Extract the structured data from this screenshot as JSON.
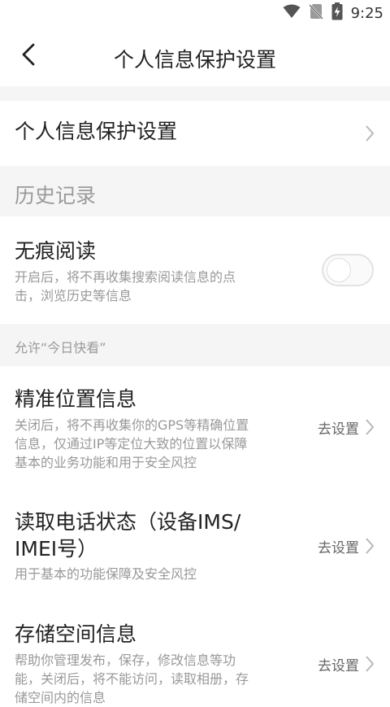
{
  "status_bar": {
    "time": "9:25",
    "icons": [
      "wifi-icon",
      "no-sim-icon",
      "battery-charging-icon"
    ]
  },
  "header": {
    "title": "个人信息保护设置",
    "back_icon": "chevron-left-icon"
  },
  "main": {
    "personal_info_item": {
      "label": "个人信息保护设置"
    },
    "history_section": {
      "title": "历史记录"
    },
    "incognito": {
      "title": "无痕阅读",
      "desc_line1": "开启后，将不再收集搜索阅读信息的点",
      "desc_line2": "击，浏览历史等信息",
      "enabled": false
    },
    "permissions_header": {
      "title": "允许“今日快看”"
    },
    "permissions": [
      {
        "title_line1": "精准位置信息",
        "title_line2": "",
        "desc_line1": "关闭后，将不再收集你的GPS等精确位置",
        "desc_line2": "信息，仅通过IP等定位大致的位置以保障",
        "desc_line3": "基本的业务功能和用于安全风控",
        "action": "去设置"
      },
      {
        "title_line1": "读取电话状态（设备IMS/",
        "title_line2": "IMEI号）",
        "desc_line1": "用于基本的功能保障及安全风控",
        "desc_line2": "",
        "desc_line3": "",
        "action": "去设置"
      },
      {
        "title_line1": "存储空间信息",
        "title_line2": "",
        "desc_line1": "帮助你管理发布，保存，修改信息等功",
        "desc_line2": "能，关闭后，将不能访问，读取相册，存",
        "desc_line3": "储空间内的信息",
        "action": "去设置"
      }
    ]
  },
  "colors": {
    "background": "#ffffff",
    "section_gap": "#f5f5f5",
    "primary_text": "#222222",
    "secondary_text": "#999999",
    "chevron": "#b8b8b8"
  }
}
